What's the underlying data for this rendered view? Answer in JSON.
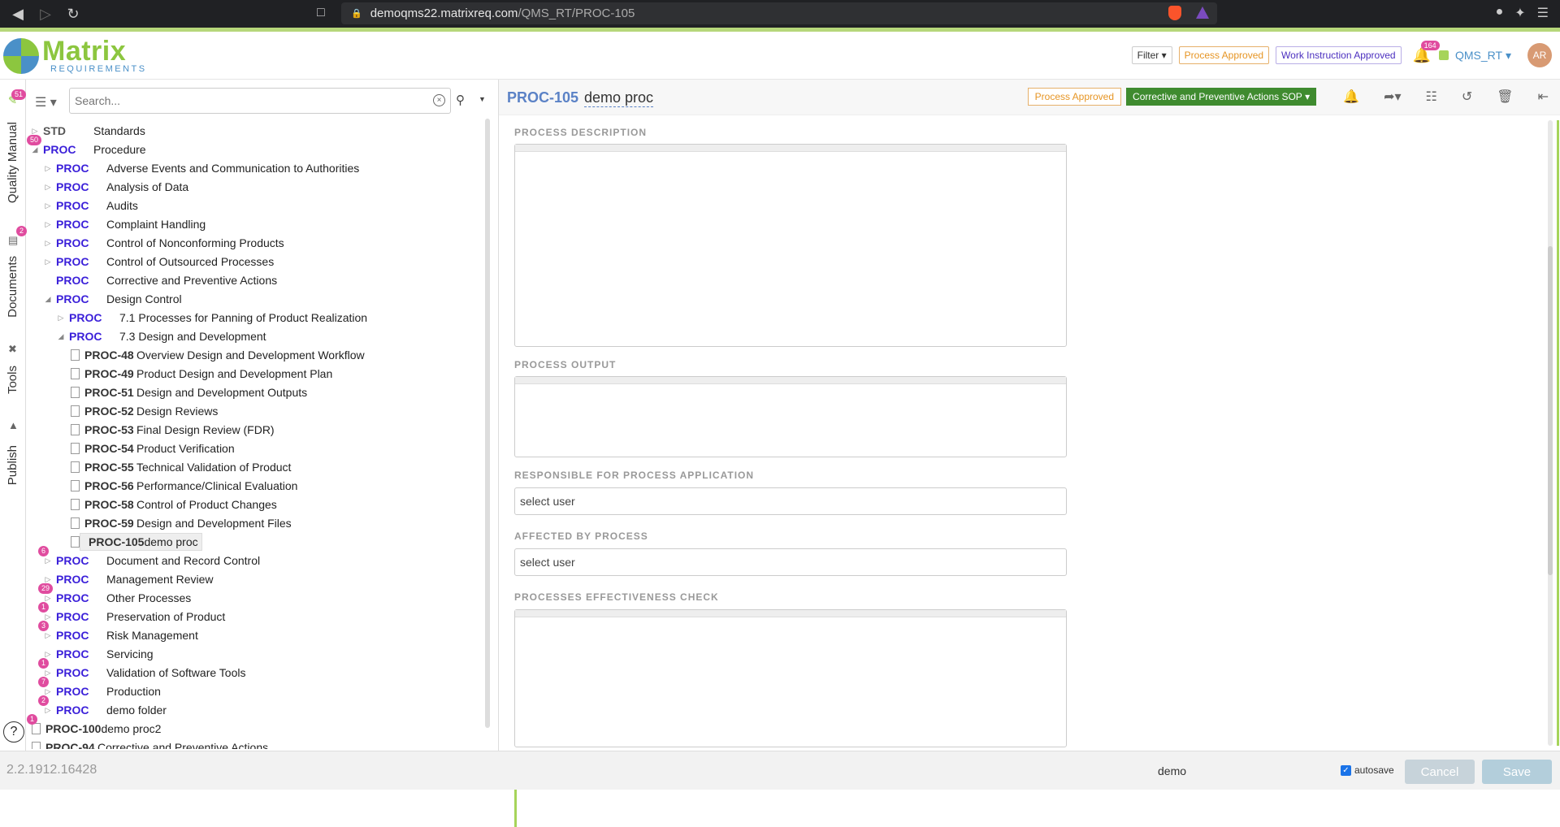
{
  "browser": {
    "url_host": "demoqms22.matrixreq.com",
    "url_path": "/QMS_RT/PROC-105"
  },
  "header": {
    "logo_title": "Matrix",
    "logo_subtitle": "REQUIREMENTS",
    "filter_label": "Filter",
    "process_approved": "Process Approved",
    "work_instruction_approved": "Work Instruction Approved",
    "notifications_count": "164",
    "project_name": "QMS_RT",
    "user_initials": "AR"
  },
  "rail": {
    "quality_manual": "Quality Manual",
    "quality_manual_badge": "51",
    "documents": "Documents",
    "documents_badge": "2",
    "tools": "Tools",
    "publish": "Publish",
    "help": "?"
  },
  "tree": {
    "search_placeholder": "Search...",
    "rows": [
      {
        "code": "STD",
        "label": "Standards",
        "arrow": "▷"
      },
      {
        "code": "PROC",
        "label": "Procedure",
        "arrow": "◢",
        "badge": "50"
      },
      {
        "code": "PROC",
        "label": "Adverse Events and Communication to Authorities",
        "arrow": "▷"
      },
      {
        "code": "PROC",
        "label": "Analysis of Data",
        "arrow": "▷"
      },
      {
        "code": "PROC",
        "label": "Audits",
        "arrow": "▷"
      },
      {
        "code": "PROC",
        "label": "Complaint Handling",
        "arrow": "▷"
      },
      {
        "code": "PROC",
        "label": "Control of Nonconforming Products",
        "arrow": "▷"
      },
      {
        "code": "PROC",
        "label": "Control of Outsourced Processes",
        "arrow": "▷"
      },
      {
        "code": "PROC",
        "label": "Corrective and Preventive Actions",
        "arrow": ""
      },
      {
        "code": "PROC",
        "label": "Design Control",
        "arrow": "◢"
      },
      {
        "code": "PROC",
        "label": "7.1 Processes for Panning of Product Realization",
        "arrow": "▷"
      },
      {
        "code": "PROC",
        "label": "7.3 Design and Development",
        "arrow": "◢"
      },
      {
        "code": "PROC-48",
        "label": "Overview Design and Development Workflow"
      },
      {
        "code": "PROC-49",
        "label": "Product Design and Development Plan"
      },
      {
        "code": "PROC-51",
        "label": "Design and Development Outputs"
      },
      {
        "code": "PROC-52",
        "label": "Design Reviews"
      },
      {
        "code": "PROC-53",
        "label": "Final Design Review (FDR)"
      },
      {
        "code": "PROC-54",
        "label": "Product Verification"
      },
      {
        "code": "PROC-55",
        "label": "Technical Validation of Product"
      },
      {
        "code": "PROC-56",
        "label": "Performance/Clinical Evaluation"
      },
      {
        "code": "PROC-58",
        "label": "Control of Product Changes"
      },
      {
        "code": "PROC-59",
        "label": "Design and Development Files"
      },
      {
        "code": "PROC-105",
        "label": "demo proc"
      },
      {
        "code": "PROC",
        "label": "Document and Record Control",
        "arrow": "▷",
        "badge": "6"
      },
      {
        "code": "PROC",
        "label": "Management Review",
        "arrow": "▷"
      },
      {
        "code": "PROC",
        "label": "Other Processes",
        "arrow": "▷",
        "badge": "29"
      },
      {
        "code": "PROC",
        "label": "Preservation of Product",
        "arrow": "▷",
        "badge": "1"
      },
      {
        "code": "PROC",
        "label": "Risk Management",
        "arrow": "▷",
        "badge": "3"
      },
      {
        "code": "PROC",
        "label": "Servicing",
        "arrow": "▷"
      },
      {
        "code": "PROC",
        "label": "Validation of Software Tools",
        "arrow": "▷",
        "badge": "1"
      },
      {
        "code": "PROC",
        "label": "Production",
        "arrow": "▷",
        "badge": "7"
      },
      {
        "code": "PROC",
        "label": "demo folder",
        "arrow": "▷",
        "badge": "2"
      },
      {
        "code": "PROC-100",
        "label": "demo proc2",
        "badge": "1"
      },
      {
        "code": "PROC-94",
        "label": "Corrective and Preventive Actions"
      }
    ]
  },
  "detail": {
    "item_id": "PROC-105",
    "item_title": "demo proc",
    "status_label": "Process Approved",
    "sop_label": "Corrective and Preventive Actions SOP",
    "fields": {
      "process_description": "PROCESS DESCRIPTION",
      "process_output": "PROCESS OUTPUT",
      "responsible": "RESPONSIBLE FOR PROCESS APPLICATION",
      "affected": "AFFECTED BY PROCESS",
      "effectiveness": "PROCESSES EFFECTIVENESS CHECK"
    },
    "select_user": "select user"
  },
  "footer": {
    "version": "2.2.1912.16428",
    "comment_value": "demo",
    "autosave": "autosave",
    "cancel": "Cancel",
    "save": "Save"
  }
}
